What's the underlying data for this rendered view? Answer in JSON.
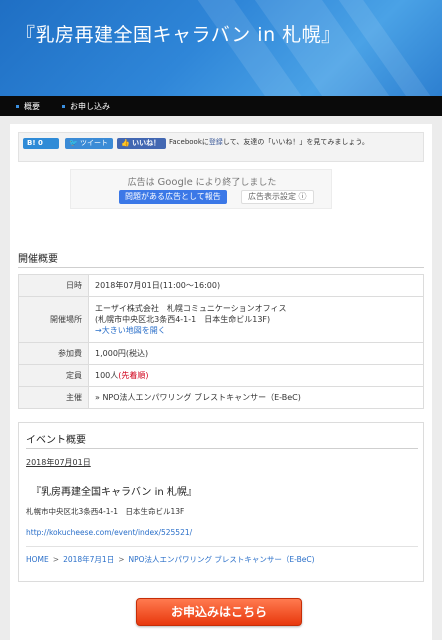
{
  "header": {
    "title": "『乳房再建全国キャラバン in 札幌』"
  },
  "nav": {
    "items": [
      "概要",
      "お申し込み"
    ]
  },
  "social": {
    "hatena_label": "B! 0",
    "tweet_label": "ツイート",
    "like_label": "いいね！",
    "fb_text_pre": "Facebookに",
    "fb_link": "登録",
    "fb_text_post": "して、友達の「いいね！」を見てみましょう。"
  },
  "ad": {
    "line_pre": "広告は",
    "line_google": "Google",
    "line_post": "により終了しました",
    "report_label": "問題がある広告として報告",
    "settings_label": "広告表示設定 ⓘ"
  },
  "overview": {
    "title": "開催概要",
    "rows": {
      "datetime": {
        "label": "日時",
        "value": "2018年07月01日(11:00〜16:00)"
      },
      "venue": {
        "label": "開催場所",
        "line1": "エーザイ株式会社　札幌コミュニケーションオフィス",
        "line2": "(札幌市中央区北3条西4-1-1　日本生命ビル13F)",
        "map_link": "→大きい地図を開く"
      },
      "fee": {
        "label": "参加費",
        "value": "1,000円(税込)"
      },
      "capacity": {
        "label": "定員",
        "value": "100人",
        "note": "(先着順)"
      },
      "organizer": {
        "label": "主催",
        "value": "» NPO法人エンパワリング ブレストキャンサー（E-BeC)"
      }
    }
  },
  "event": {
    "title": "イベント概要",
    "date": "2018年07月01日",
    "name": "『乳房再建全国キャラバン in 札幌』",
    "address": "札幌市中央区北3条西4-1-1　日本生命ビル13F",
    "url": "http://kokucheese.com/event/index/525521/",
    "breadcrumb": [
      "HOME",
      "2018年7月1日",
      "NPO法人エンパワリング ブレストキャンサー（E-BeC)"
    ],
    "breadcrumb_sep": ">"
  },
  "apply_button": {
    "label": "お申込みはこちら"
  },
  "colors": {
    "header_blue": "#2f86d8",
    "nav_black": "#0a0a0a",
    "link_blue": "#2a6fc9",
    "apply_orange": "#e8380d",
    "accent_red": "#d0021b"
  }
}
